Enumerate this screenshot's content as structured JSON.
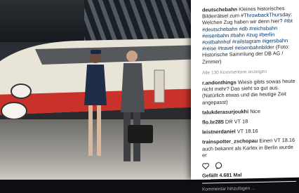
{
  "post": {
    "username": "deutschebahn",
    "caption_lines": [
      "Kleines historisches",
      "Bilderrätsel zum",
      "Weichen Zug haben wir denn hier?",
      "",
      "",
      "",
      "",
      "Zimmer)"
    ],
    "caption_text": "Kleines historisches Bilderrätsel zum #ThrowbackThursday: Welchen Zug haben wir denn hier? #tbt #deutschebahn #db #reichsbahn #eisenbahn #bahn #zug #berlin #ostbahnhof #railstagram #igersbahn #reise #travel #eisenbahnbilder (Foto: Historische Sammlung der DB AG / Zimmer)",
    "more_comments": "Alle 130 Kommentare anzeigen"
  },
  "comments": [
    {
      "user": "r.andonthings",
      "text": "Wieso gibts sowas heute nicht mehr? Das sieht so gut aus. (Natürlich etwas und die heutige Zeit angepasst)"
    },
    {
      "user": "talukderasurjoukhi",
      "text": "Nice"
    },
    {
      "user": "flo.br285",
      "text": "DR VT 18"
    },
    {
      "user": "leistnerdaniel",
      "text": "VT 18.16"
    },
    {
      "user": "trainspotter_zschopau",
      "text": "Einen VT 18.16 auch bekannt als Karlex in Berlin wurde er"
    }
  ],
  "likes": "Gefällt 4.681 Mal",
  "add_comment_placeholder": "Kommentar hinzufügen ..."
}
